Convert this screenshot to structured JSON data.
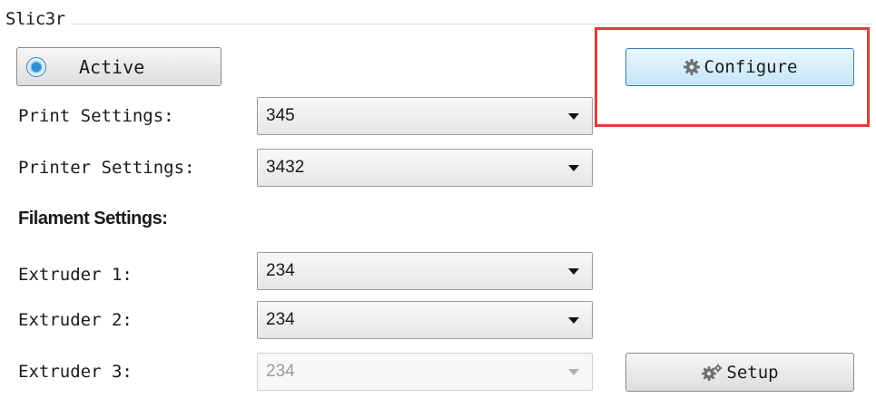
{
  "group": {
    "title": "Slic3r"
  },
  "active_button": {
    "label": "Active"
  },
  "configure_button": {
    "label": "Configure",
    "icon": "gear-icon"
  },
  "setup_button": {
    "label": "Setup",
    "icon": "gears-icon"
  },
  "print_settings": {
    "label": "Print Settings:",
    "value": "345"
  },
  "printer_settings": {
    "label": "Printer Settings:",
    "value": "3432"
  },
  "filament": {
    "heading": "Filament Settings:",
    "extruders": [
      {
        "label": "Extruder 1:",
        "value": "234",
        "enabled": true
      },
      {
        "label": "Extruder 2:",
        "value": "234",
        "enabled": true
      },
      {
        "label": "Extruder 3:",
        "value": "234",
        "enabled": false
      }
    ]
  },
  "colors": {
    "highlight": "#e23b3b",
    "accent": "#3c7fb1"
  }
}
